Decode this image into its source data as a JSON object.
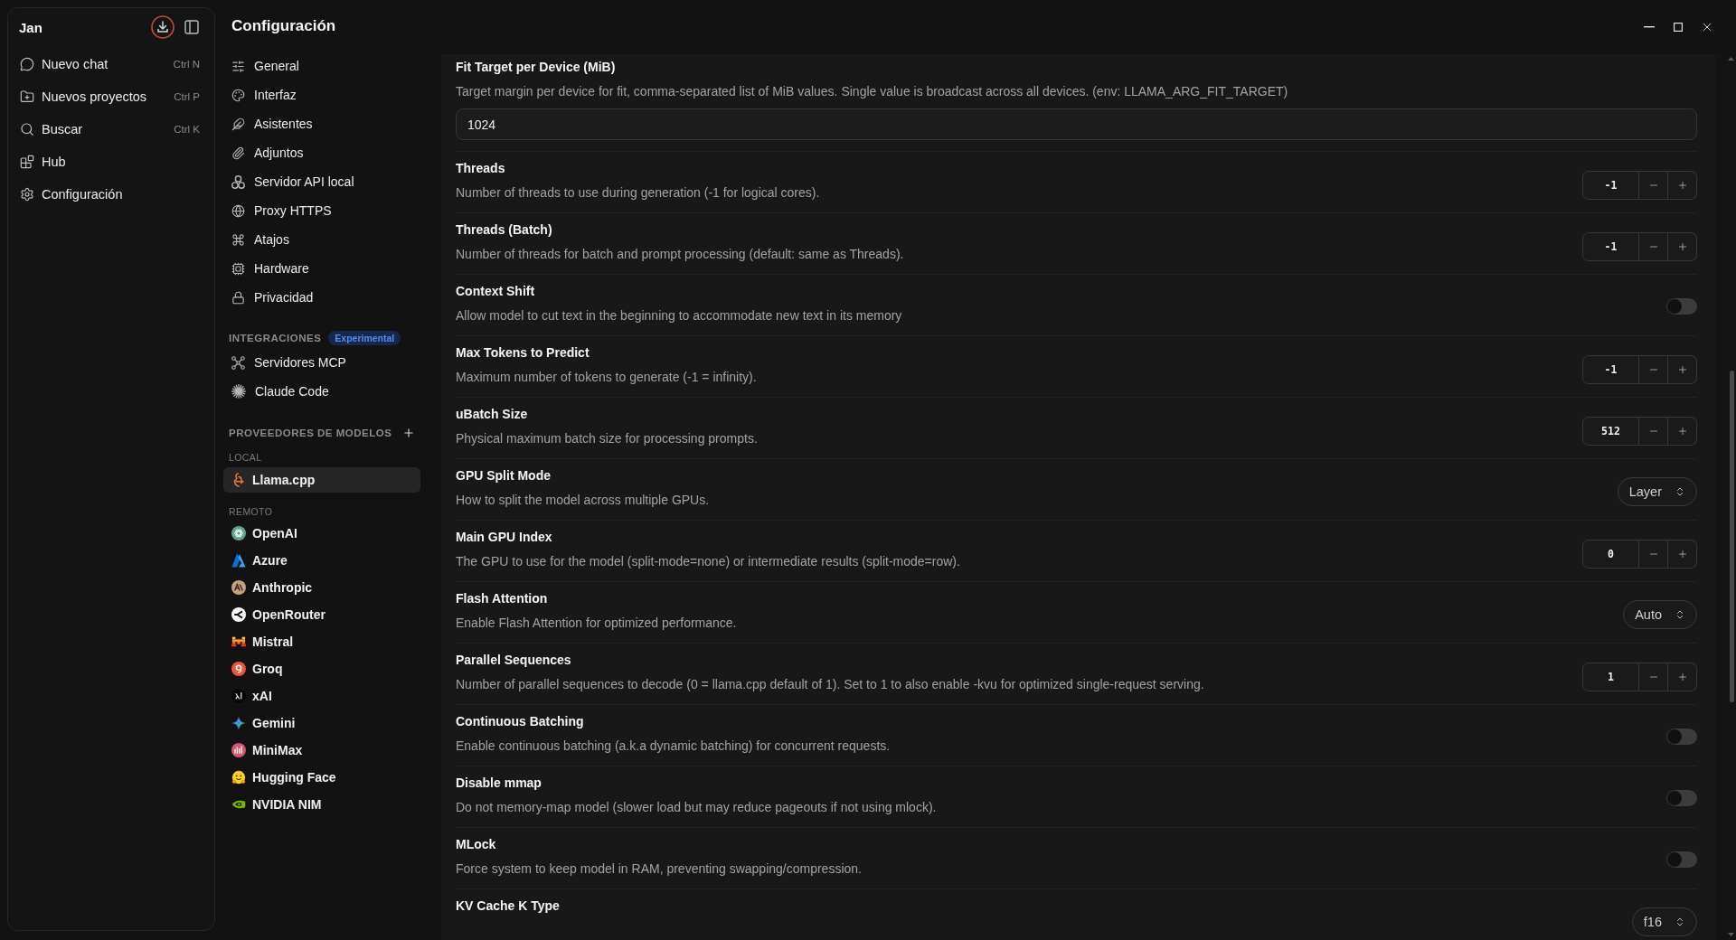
{
  "app_sidebar": {
    "title": "Jan",
    "items": [
      {
        "label": "Nuevo chat",
        "shortcut": "Ctrl N"
      },
      {
        "label": "Nuevos proyectos",
        "shortcut": "Ctrl P"
      },
      {
        "label": "Buscar",
        "shortcut": "Ctrl K"
      },
      {
        "label": "Hub"
      },
      {
        "label": "Configuración"
      }
    ]
  },
  "settings_nav": {
    "title": "Configuración",
    "items": [
      {
        "label": "General",
        "selected": false
      },
      {
        "label": "Interfaz",
        "selected": false
      },
      {
        "label": "Asistentes",
        "selected": false
      },
      {
        "label": "Adjuntos",
        "selected": false
      },
      {
        "label": "Servidor API local",
        "selected": false
      },
      {
        "label": "Proxy HTTPS",
        "selected": false
      },
      {
        "label": "Atajos",
        "selected": false
      },
      {
        "label": "Hardware",
        "selected": false
      },
      {
        "label": "Privacidad",
        "selected": false
      }
    ],
    "integrations": {
      "heading": "INTEGRACIONES",
      "badge": "Experimental",
      "items": [
        {
          "label": "Servidores MCP",
          "selected": false
        },
        {
          "label": "Claude Code",
          "selected": false
        }
      ]
    },
    "providers": {
      "heading": "PROVEEDORES DE MODELOS",
      "groups": [
        {
          "heading": "LOCAL",
          "items": [
            {
              "label": "Llama.cpp",
              "selected": true
            }
          ]
        },
        {
          "heading": "REMOTO",
          "items": [
            {
              "label": "OpenAI",
              "selected": false
            },
            {
              "label": "Azure",
              "selected": false
            },
            {
              "label": "Anthropic",
              "selected": false
            },
            {
              "label": "OpenRouter",
              "selected": false
            },
            {
              "label": "Mistral",
              "selected": false
            },
            {
              "label": "Groq",
              "selected": false
            },
            {
              "label": "xAI",
              "selected": false
            },
            {
              "label": "Gemini",
              "selected": false
            },
            {
              "label": "MiniMax",
              "selected": false
            },
            {
              "label": "Hugging Face",
              "selected": false
            },
            {
              "label": "NVIDIA NIM",
              "selected": false
            }
          ]
        }
      ]
    }
  },
  "settings": [
    {
      "kind": "text",
      "title": "Fit Target per Device (MiB)",
      "description": "Target margin per device for fit, comma-separated list of MiB values. Single value is broadcast across all devices. (env: LLAMA_ARG_FIT_TARGET)",
      "value": "1024"
    },
    {
      "kind": "number",
      "title": "Threads",
      "description": "Number of threads to use during generation (-1 for logical cores).",
      "value": "-1"
    },
    {
      "kind": "number",
      "title": "Threads (Batch)",
      "description": "Number of threads for batch and prompt processing (default: same as Threads).",
      "value": "-1"
    },
    {
      "kind": "toggle",
      "title": "Context Shift",
      "description": "Allow model to cut text in the beginning to accommodate new text in its memory",
      "on": false
    },
    {
      "kind": "number",
      "title": "Max Tokens to Predict",
      "description": "Maximum number of tokens to generate (-1 = infinity).",
      "value": "-1"
    },
    {
      "kind": "number",
      "title": "uBatch Size",
      "description": "Physical maximum batch size for processing prompts.",
      "value": "512"
    },
    {
      "kind": "select",
      "title": "GPU Split Mode",
      "description": "How to split the model across multiple GPUs.",
      "value": "Layer"
    },
    {
      "kind": "number",
      "title": "Main GPU Index",
      "description": "The GPU to use for the model (split-mode=none) or intermediate results (split-mode=row).",
      "value": "0"
    },
    {
      "kind": "select",
      "title": "Flash Attention",
      "description": "Enable Flash Attention for optimized performance.",
      "value": "Auto"
    },
    {
      "kind": "number",
      "title": "Parallel Sequences",
      "description": "Number of parallel sequences to decode (0 = llama.cpp default of 1). Set to 1 to also enable -kvu for optimized single-request serving.",
      "value": "1"
    },
    {
      "kind": "toggle",
      "title": "Continuous Batching",
      "description": "Enable continuous batching (a.k.a dynamic batching) for concurrent requests.",
      "on": false
    },
    {
      "kind": "toggle",
      "title": "Disable mmap",
      "description": "Do not memory-map model (slower load but may reduce pageouts if not using mlock).",
      "on": false
    },
    {
      "kind": "toggle",
      "title": "MLock",
      "description": "Force system to keep model in RAM, preventing swapping/compression.",
      "on": false
    },
    {
      "kind": "select",
      "title": "KV Cache K Type",
      "value": "f16"
    }
  ]
}
